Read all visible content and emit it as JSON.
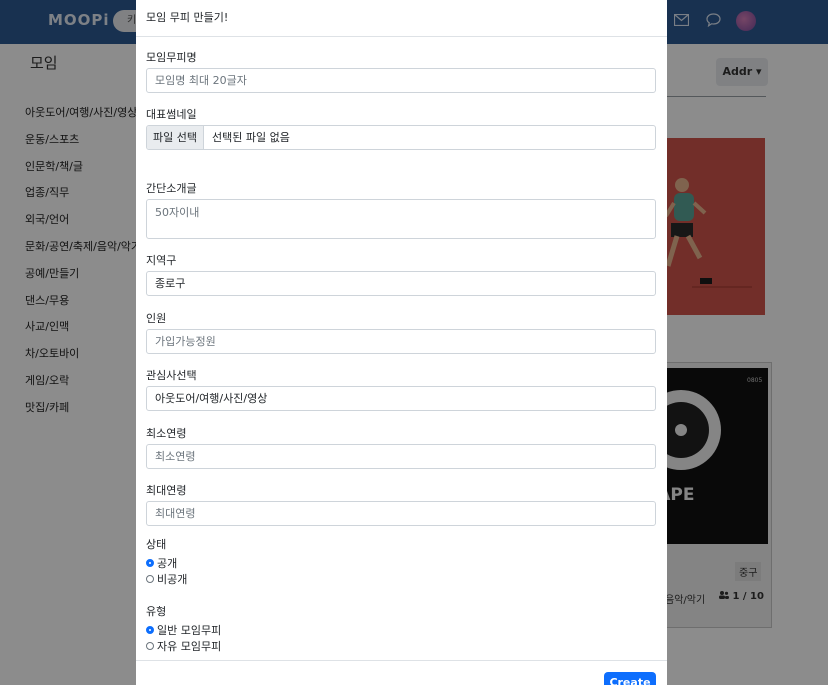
{
  "navbar": {
    "brand": "MOOPi",
    "search_text": "키"
  },
  "page": {
    "title": "모임",
    "addr_button": "Addr",
    "categories": [
      "아웃도어/여행/사진/영상",
      "운동/스포츠",
      "인문학/책/글",
      "업종/직무",
      "외국/언어",
      "문화/공연/축제/음악/악기",
      "공예/만들기",
      "댄스/무용",
      "사교/인맥",
      "차/오토바이",
      "게임/오락",
      "맛집/카페"
    ],
    "card": {
      "image_label": "TAPE",
      "image_corner": "0805",
      "tag": "중구",
      "category": "음악/악기",
      "count": "1 / 10"
    }
  },
  "modal": {
    "title": "모임 무피 만들기!",
    "name_label": "모임무피명",
    "name_placeholder": "모임명 최대 20글자",
    "thumb_label": "대표썸네일",
    "file_button": "파일 선택",
    "file_status": "선택된 파일 없음",
    "intro_label": "간단소개글",
    "intro_placeholder": "50자이내",
    "region_label": "지역구",
    "region_value": "종로구",
    "members_label": "인원",
    "members_placeholder": "가입가능정원",
    "interest_label": "관심사선택",
    "interest_value": "아웃도어/여행/사진/영상",
    "min_age_label": "최소연령",
    "min_age_placeholder": "최소연령",
    "max_age_label": "최대연령",
    "max_age_placeholder": "최대연령",
    "status_label": "상태",
    "status_options": [
      "공개",
      "비공개"
    ],
    "type_label": "유형",
    "type_options": [
      "일반 모임무피",
      "자유 모임무피"
    ],
    "create_button": "Create"
  }
}
